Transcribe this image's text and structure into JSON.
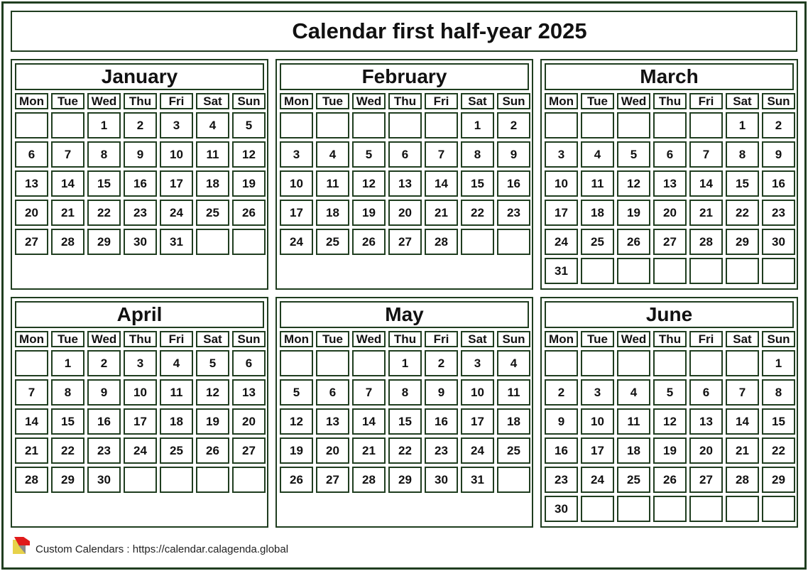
{
  "title": "Calendar first half-year 2025",
  "weekdays": [
    "Mon",
    "Tue",
    "Wed",
    "Thu",
    "Fri",
    "Sat",
    "Sun"
  ],
  "months": [
    {
      "name": "January",
      "weeks": [
        [
          "",
          "",
          "1",
          "2",
          "3",
          "4",
          "5"
        ],
        [
          "6",
          "7",
          "8",
          "9",
          "10",
          "11",
          "12"
        ],
        [
          "13",
          "14",
          "15",
          "16",
          "17",
          "18",
          "19"
        ],
        [
          "20",
          "21",
          "22",
          "23",
          "24",
          "25",
          "26"
        ],
        [
          "27",
          "28",
          "29",
          "30",
          "31",
          "",
          ""
        ]
      ]
    },
    {
      "name": "February",
      "weeks": [
        [
          "",
          "",
          "",
          "",
          "",
          "1",
          "2"
        ],
        [
          "3",
          "4",
          "5",
          "6",
          "7",
          "8",
          "9"
        ],
        [
          "10",
          "11",
          "12",
          "13",
          "14",
          "15",
          "16"
        ],
        [
          "17",
          "18",
          "19",
          "20",
          "21",
          "22",
          "23"
        ],
        [
          "24",
          "25",
          "26",
          "27",
          "28",
          "",
          ""
        ]
      ]
    },
    {
      "name": "March",
      "weeks": [
        [
          "",
          "",
          "",
          "",
          "",
          "1",
          "2"
        ],
        [
          "3",
          "4",
          "5",
          "6",
          "7",
          "8",
          "9"
        ],
        [
          "10",
          "11",
          "12",
          "13",
          "14",
          "15",
          "16"
        ],
        [
          "17",
          "18",
          "19",
          "20",
          "21",
          "22",
          "23"
        ],
        [
          "24",
          "25",
          "26",
          "27",
          "28",
          "29",
          "30"
        ],
        [
          "31",
          "",
          "",
          "",
          "",
          "",
          ""
        ]
      ]
    },
    {
      "name": "April",
      "weeks": [
        [
          "",
          "1",
          "2",
          "3",
          "4",
          "5",
          "6"
        ],
        [
          "7",
          "8",
          "9",
          "10",
          "11",
          "12",
          "13"
        ],
        [
          "14",
          "15",
          "16",
          "17",
          "18",
          "19",
          "20"
        ],
        [
          "21",
          "22",
          "23",
          "24",
          "25",
          "26",
          "27"
        ],
        [
          "28",
          "29",
          "30",
          "",
          "",
          "",
          ""
        ]
      ]
    },
    {
      "name": "May",
      "weeks": [
        [
          "",
          "",
          "",
          "1",
          "2",
          "3",
          "4"
        ],
        [
          "5",
          "6",
          "7",
          "8",
          "9",
          "10",
          "11"
        ],
        [
          "12",
          "13",
          "14",
          "15",
          "16",
          "17",
          "18"
        ],
        [
          "19",
          "20",
          "21",
          "22",
          "23",
          "24",
          "25"
        ],
        [
          "26",
          "27",
          "28",
          "29",
          "30",
          "31",
          ""
        ]
      ]
    },
    {
      "name": "June",
      "weeks": [
        [
          "",
          "",
          "",
          "",
          "",
          "",
          "1"
        ],
        [
          "2",
          "3",
          "4",
          "5",
          "6",
          "7",
          "8"
        ],
        [
          "9",
          "10",
          "11",
          "12",
          "13",
          "14",
          "15"
        ],
        [
          "16",
          "17",
          "18",
          "19",
          "20",
          "21",
          "22"
        ],
        [
          "23",
          "24",
          "25",
          "26",
          "27",
          "28",
          "29"
        ],
        [
          "30",
          "",
          "",
          "",
          "",
          "",
          ""
        ]
      ]
    }
  ],
  "footer": {
    "text": "Custom Calendars : https://calendar.calagenda.global",
    "logo_icon": "calagenda-logo-icon"
  }
}
